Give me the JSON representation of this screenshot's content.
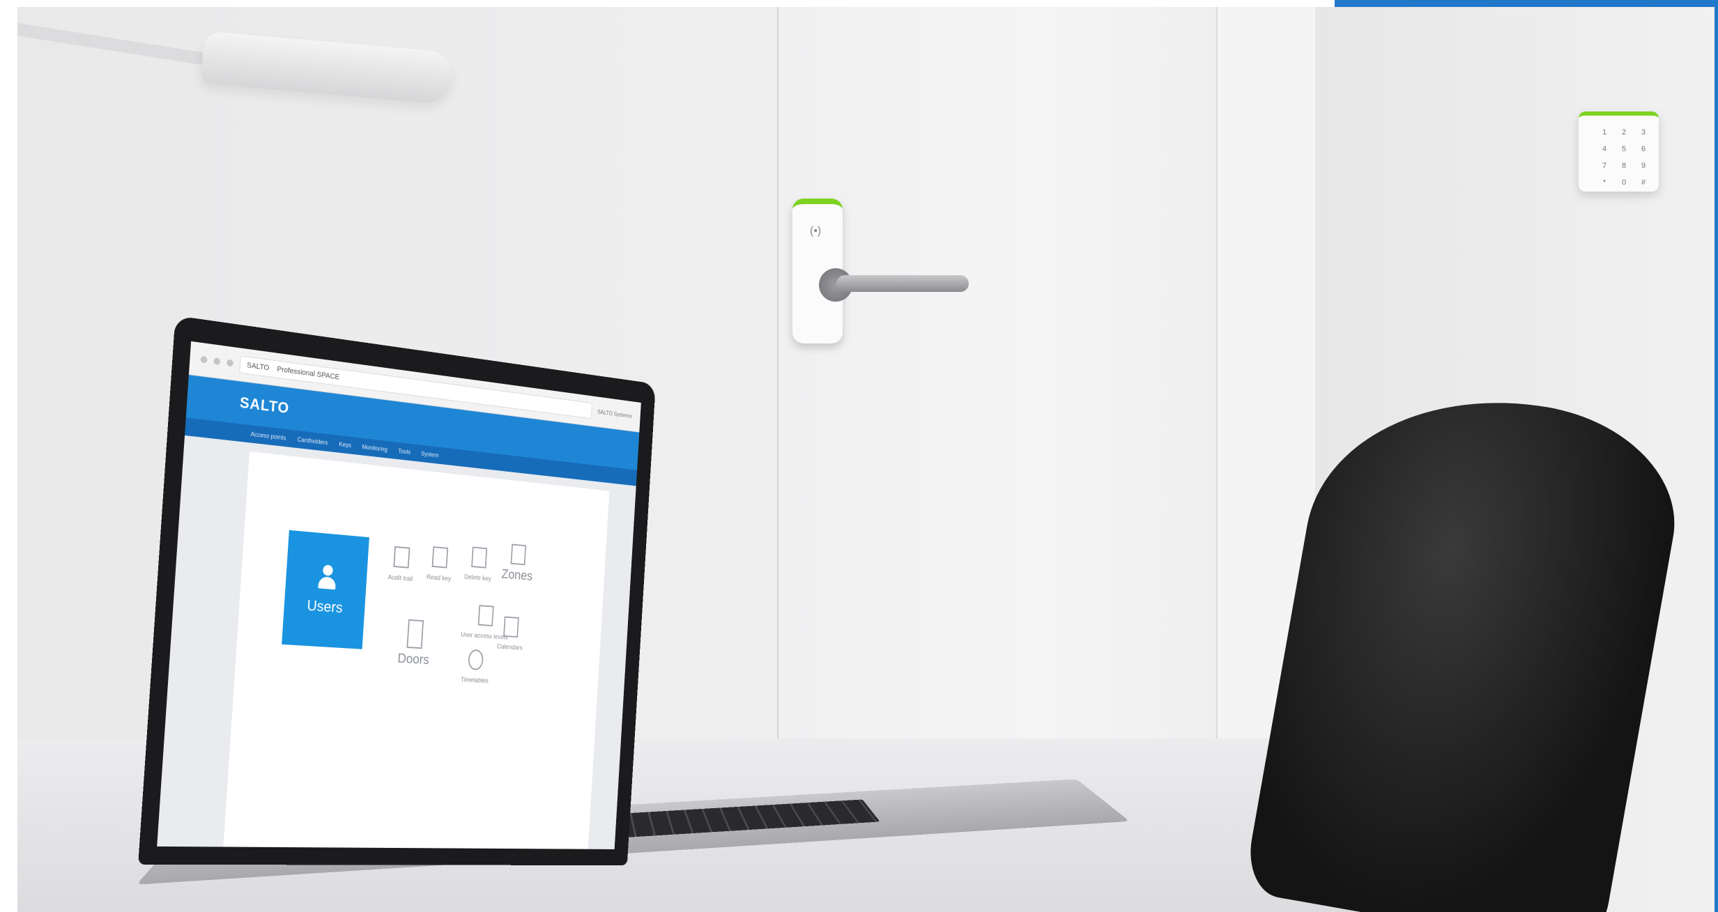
{
  "browser": {
    "tab_label": "SALTO",
    "url": "Professional SPACE",
    "account": "SALTO Systems"
  },
  "app": {
    "logo": "SALTO",
    "nav": [
      "Access points",
      "Cardholders",
      "Keys",
      "Monitoring",
      "Tools",
      "System"
    ]
  },
  "dashboard": {
    "users_label": "Users",
    "tiles": [
      {
        "id": "audit-trail",
        "label": "Audit trail"
      },
      {
        "id": "read-key",
        "label": "Read key"
      },
      {
        "id": "delete-key",
        "label": "Delete key"
      },
      {
        "id": "zones",
        "label": "Zones"
      },
      {
        "id": "doors",
        "label": "Doors"
      },
      {
        "id": "user-access-levels",
        "label": "User access levels"
      },
      {
        "id": "calendars",
        "label": "Calendars"
      },
      {
        "id": "timetables",
        "label": "Timetables"
      }
    ]
  },
  "keypad": {
    "keys": [
      "1",
      "2",
      "3",
      "4",
      "5",
      "6",
      "7",
      "8",
      "9",
      "*",
      "0",
      "#"
    ]
  },
  "colors": {
    "brand_blue": "#1f86d6",
    "status_green": "#7ed321"
  }
}
